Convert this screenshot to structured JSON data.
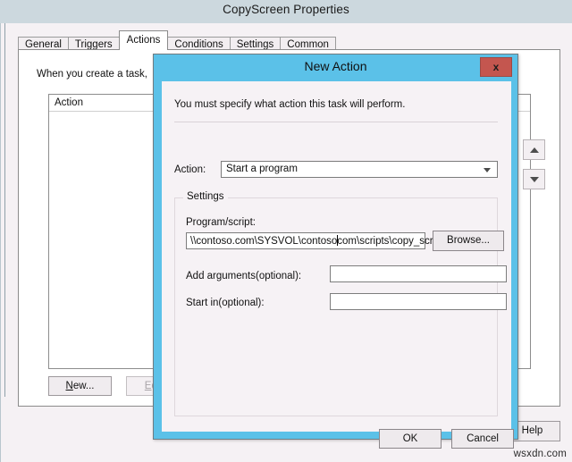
{
  "outer_window": {
    "title": "CopyScreen Properties",
    "tabs": [
      {
        "label": "General",
        "active": false
      },
      {
        "label": "Triggers",
        "active": false
      },
      {
        "label": "Actions",
        "active": true
      },
      {
        "label": "Conditions",
        "active": false
      },
      {
        "label": "Settings",
        "active": false
      },
      {
        "label": "Common",
        "active": false
      }
    ],
    "intro_text": "When you create a task, ",
    "list_header": "Action",
    "buttons": {
      "new": "New...",
      "new_accesskey": "N",
      "edit": "Edit...",
      "edit_accesskey": "E",
      "help": "Help"
    },
    "nudge": {
      "up_icon": "triangle-up-icon",
      "down_icon": "triangle-down-icon"
    }
  },
  "dialog": {
    "title": "New Action",
    "close_label": "x",
    "close_icon": "close-icon",
    "instruction": "You must specify what action this task will perform.",
    "action_row": {
      "label": "Action:",
      "selected": "Start a program",
      "caret_icon": "chevron-down-icon"
    },
    "settings_group": {
      "legend": "Settings",
      "program_label": "Program/script:",
      "program_value_before_caret": "\\\\contoso.com\\SYSVOL\\contoso",
      "program_value_after_caret": "com\\scripts\\copy_scr",
      "browse_label": "Browse...",
      "arguments_label": "Add arguments(optional):",
      "arguments_value": "",
      "arguments_placeholder": "",
      "startin_label": "Start in(optional):",
      "startin_value": "",
      "startin_placeholder": ""
    },
    "footer": {
      "ok": "OK",
      "cancel": "Cancel"
    }
  },
  "watermark": "wsxdn.com",
  "colors": {
    "outer_titlebar": "#ccd8de",
    "dialog_border": "#5bc1e8",
    "dialog_face": "#f6f2f5",
    "close_button": "#c4564f",
    "page_background": "#f5f1f4"
  }
}
